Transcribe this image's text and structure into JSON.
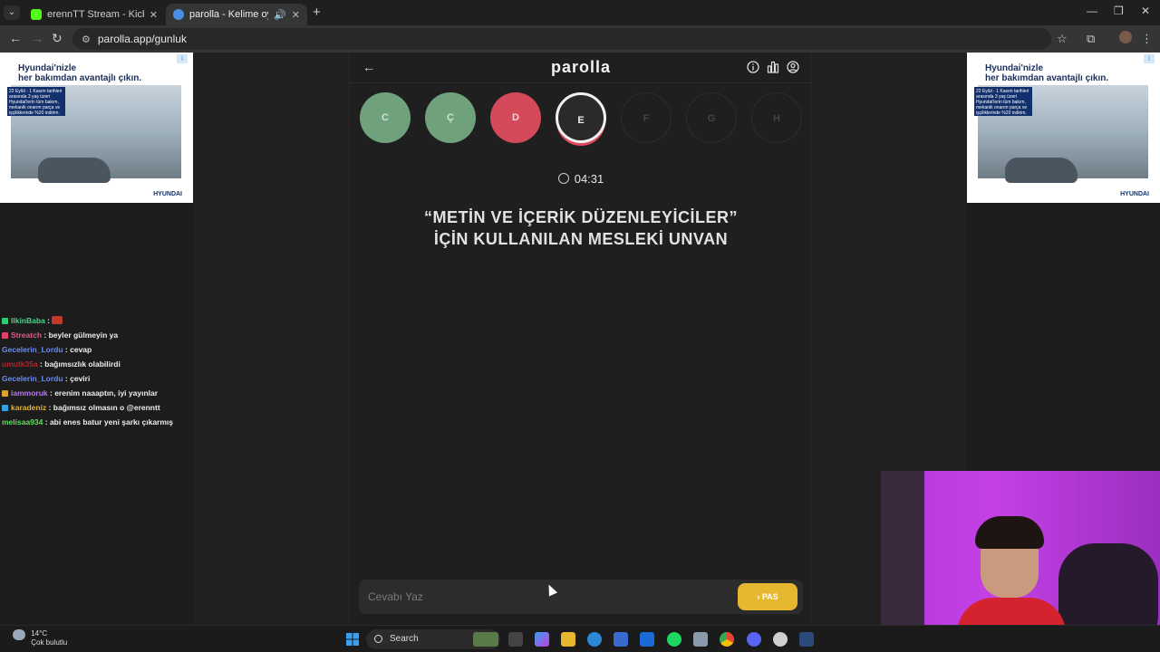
{
  "browser": {
    "tabs": [
      {
        "title": "erennTT Stream - Kick Dashboa",
        "favicon_color": "#53fc18"
      },
      {
        "title": "parolla - Kelime oyunu. Gün",
        "favicon_color": "#4a90e2"
      }
    ],
    "url": "parolla.app/gunluk"
  },
  "game": {
    "logo": "parolla",
    "letters": [
      {
        "letter": "C",
        "state": "correct"
      },
      {
        "letter": "Ç",
        "state": "correct"
      },
      {
        "letter": "D",
        "state": "wrong"
      },
      {
        "letter": "E",
        "state": "current"
      },
      {
        "letter": "F",
        "state": "pending"
      },
      {
        "letter": "G",
        "state": "pending"
      },
      {
        "letter": "H",
        "state": "pending"
      }
    ],
    "timer": "04:31",
    "question_line1": "“METİN VE İÇERİK DÜZENLEYİCİLER”",
    "question_line2": "İÇİN KULLANILAN MESLEKİ UNVAN",
    "answer_placeholder": "Cevabı Yaz",
    "pass_label": "PAS",
    "colors": {
      "correct": "#6fa27c",
      "wrong": "#d54a5a",
      "pass": "#e6b82f"
    }
  },
  "ad": {
    "headline_1": "Hyundai'nizle",
    "headline_2": "her bakımdan avantajlı çıkın.",
    "promo": "22 Eylül - 1 Kasım tarihleri arasında 3 yaş üzeri Hyundai'lerin tüm bakım, mekanik onarım parça ve işçiliklerinde %20 indirim.",
    "brand": "HYUNDAI"
  },
  "chat": [
    {
      "user": "IlkinBaba",
      "text": "",
      "color": "#4fd18b",
      "badge": "#2ecc71"
    },
    {
      "user": "Streatch",
      "text": "beyler gülmeyin ya",
      "color": "#e05a8a",
      "badge": "#e0406a"
    },
    {
      "user": "Gecelerin_Lordu",
      "text": "cevap",
      "color": "#6b8df0",
      "badge": ""
    },
    {
      "user": "umutk35a",
      "text": "bağımsızlık olabilirdi",
      "color": "#b8202a",
      "badge": ""
    },
    {
      "user": "Gecelerin_Lordu",
      "text": "çeviri",
      "color": "#6b8df0",
      "badge": ""
    },
    {
      "user": "iammoruk",
      "text": "erenim naaaptın, iyi yayınlar",
      "color": "#b57bf0",
      "badge": "#e0a030"
    },
    {
      "user": "karadeniz",
      "text": "bağımsız olmasın o @erenntt",
      "color": "#e0b030",
      "badge": "#30a0e0"
    },
    {
      "user": "melisaa934",
      "text": "abi enes batur yeni şarkı çıkarmış",
      "color": "#5ce05c",
      "badge": ""
    }
  ],
  "taskbar": {
    "temp": "14°C",
    "weather": "Çok bulutlu",
    "search": "Search"
  }
}
